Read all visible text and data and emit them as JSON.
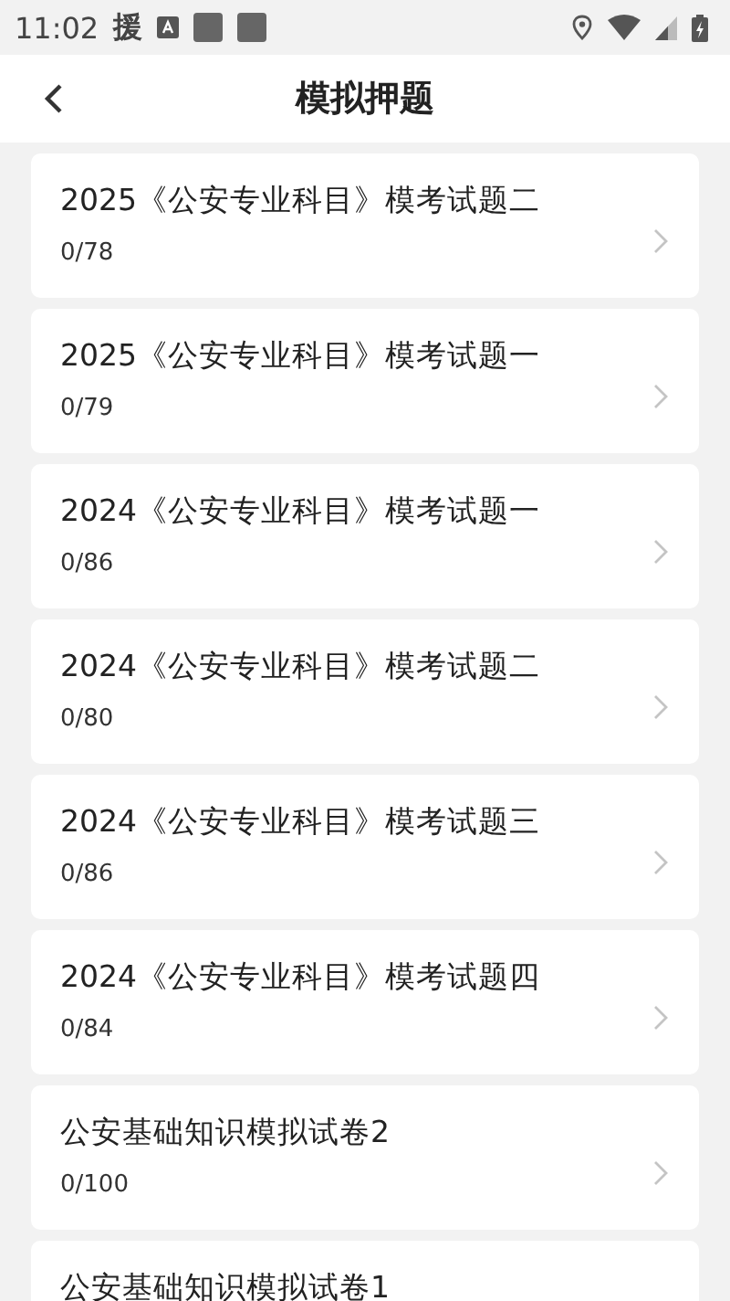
{
  "status_bar": {
    "time": "11:02",
    "notification_glyph": "援"
  },
  "header": {
    "title": "模拟押题"
  },
  "papers": [
    {
      "title": "2025《公安专业科目》模考试题二",
      "progress": "0/78"
    },
    {
      "title": "2025《公安专业科目》模考试题一",
      "progress": "0/79"
    },
    {
      "title": "2024《公安专业科目》模考试题一",
      "progress": "0/86"
    },
    {
      "title": "2024《公安专业科目》模考试题二",
      "progress": "0/80"
    },
    {
      "title": "2024《公安专业科目》模考试题三",
      "progress": "0/86"
    },
    {
      "title": "2024《公安专业科目》模考试题四",
      "progress": "0/84"
    },
    {
      "title": "公安基础知识模拟试卷2",
      "progress": "0/100"
    },
    {
      "title": "公安基础知识模拟试卷1"
    }
  ]
}
